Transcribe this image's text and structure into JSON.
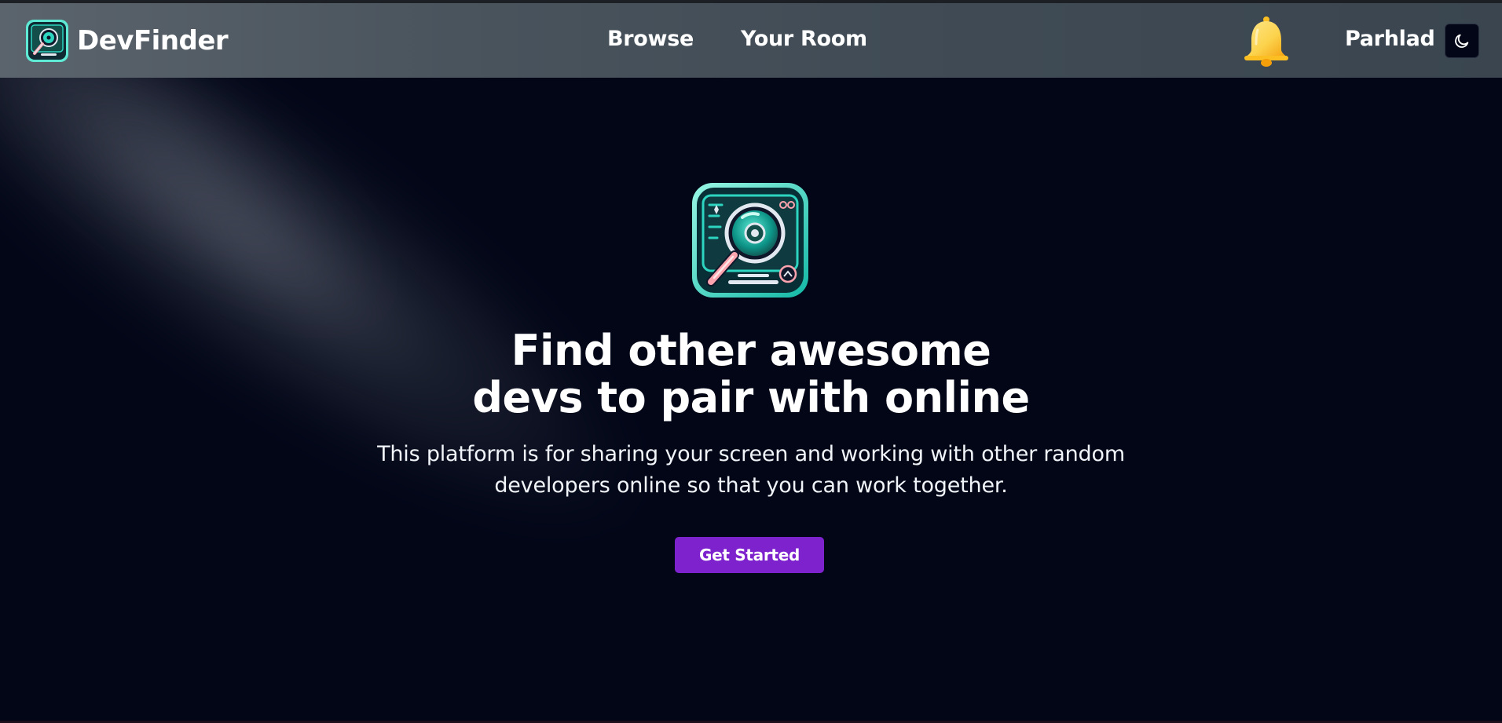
{
  "header": {
    "brand_name": "DevFinder",
    "nav": [
      {
        "label": "Browse"
      },
      {
        "label": "Your Room"
      }
    ],
    "notifications_icon": "bell-icon",
    "username": "Parhlad",
    "theme_toggle_icon": "moon-icon"
  },
  "hero": {
    "logo_icon": "magnifier-computer-icon",
    "title_line1": "Find other awesome",
    "title_line2": "devs to pair with online",
    "subtitle_line1": "This platform is for sharing your screen and working with other random",
    "subtitle_line2": "developers online so that you can work together.",
    "cta_label": "Get Started"
  },
  "colors": {
    "background": "#020617",
    "header": "#4a545d",
    "accent_purple": "#7e22ce",
    "logo_teal": "#2dd4bf",
    "bell_yellow": "#fcd34d"
  }
}
